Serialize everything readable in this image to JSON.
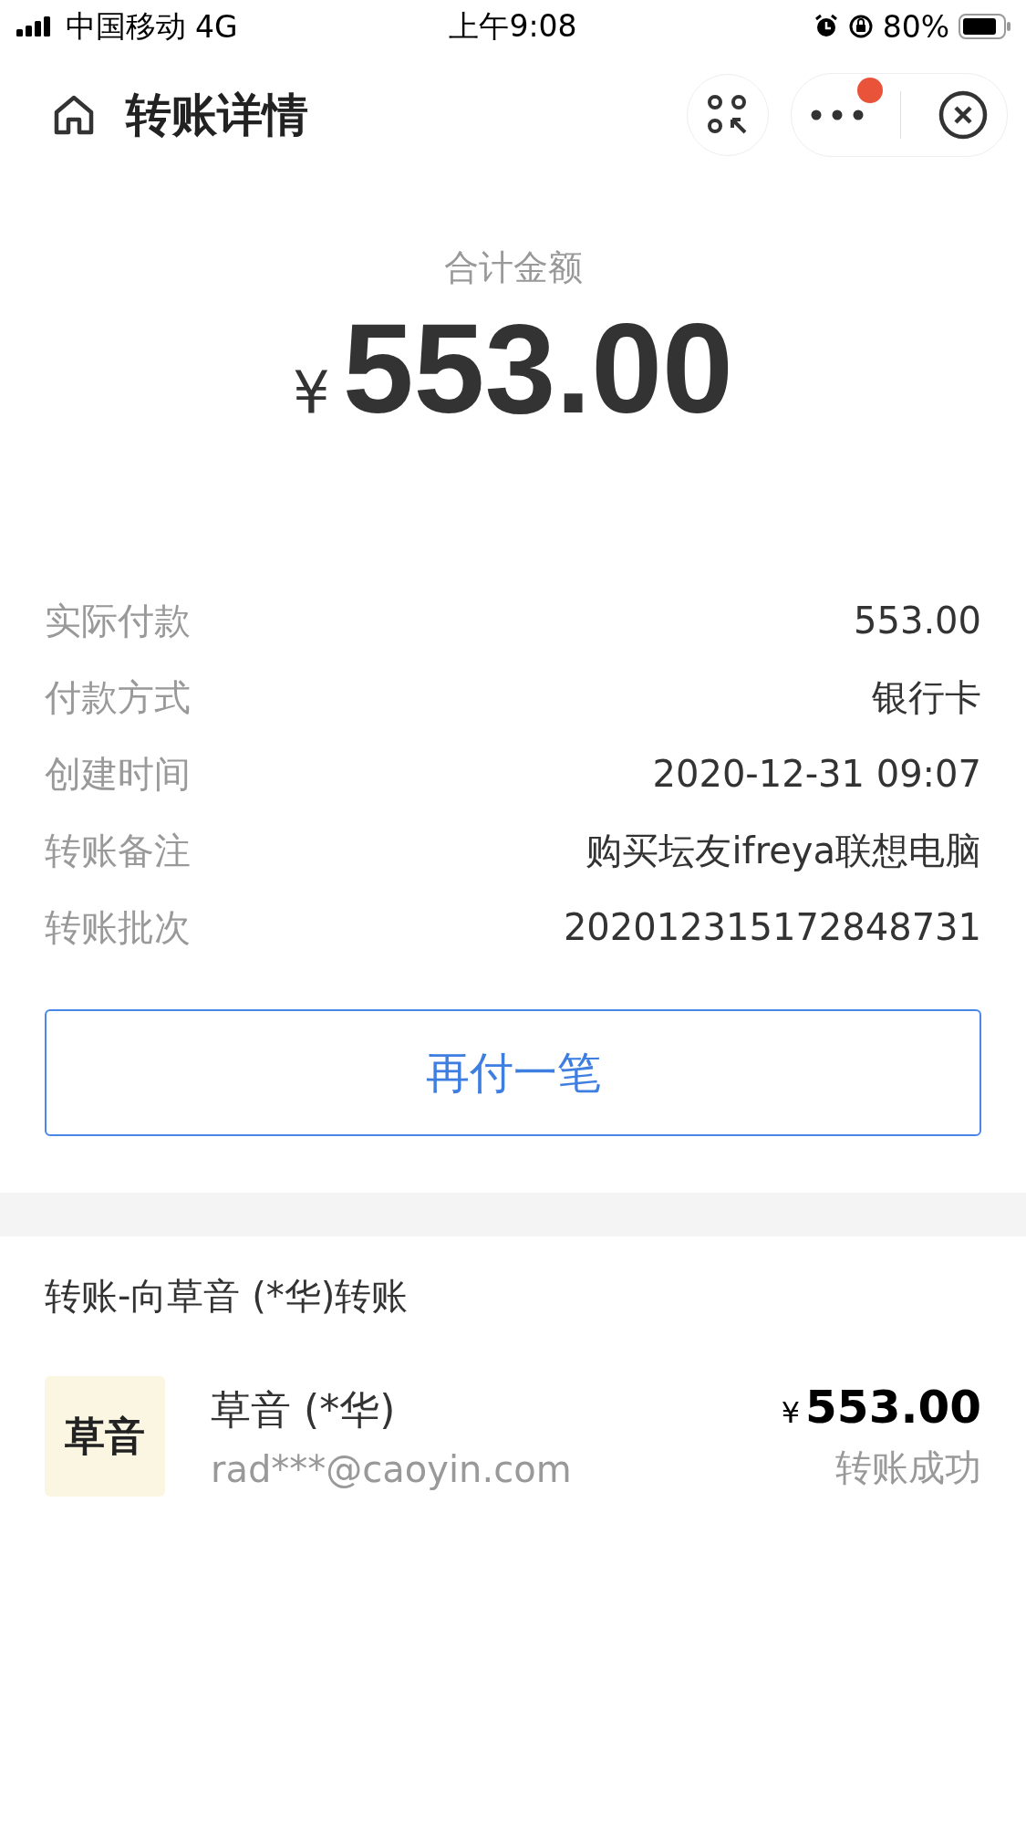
{
  "status_bar": {
    "carrier": "中国移动",
    "network": "4G",
    "time": "上午9:08",
    "battery": "80%"
  },
  "header": {
    "title": "转账详情",
    "notification_dot": true
  },
  "total": {
    "label": "合计金额",
    "currency": "¥",
    "amount": "553.00"
  },
  "details": [
    {
      "label": "实际付款",
      "value": "553.00"
    },
    {
      "label": "付款方式",
      "value": "银行卡"
    },
    {
      "label": "创建时间",
      "value": "2020-12-31 09:07"
    },
    {
      "label": "转账备注",
      "value": "购买坛友ifreya联想电脑"
    },
    {
      "label": "转账批次",
      "value": "202012315172848731"
    }
  ],
  "action_button": "再付一笔",
  "transfer": {
    "title": "转账-向草音 (*华)转账",
    "logo_text": "草音",
    "payee": "草音 (*华)",
    "account": "rad***@caoyin.com",
    "currency": "¥",
    "amount": "553.00",
    "status": "转账成功"
  }
}
